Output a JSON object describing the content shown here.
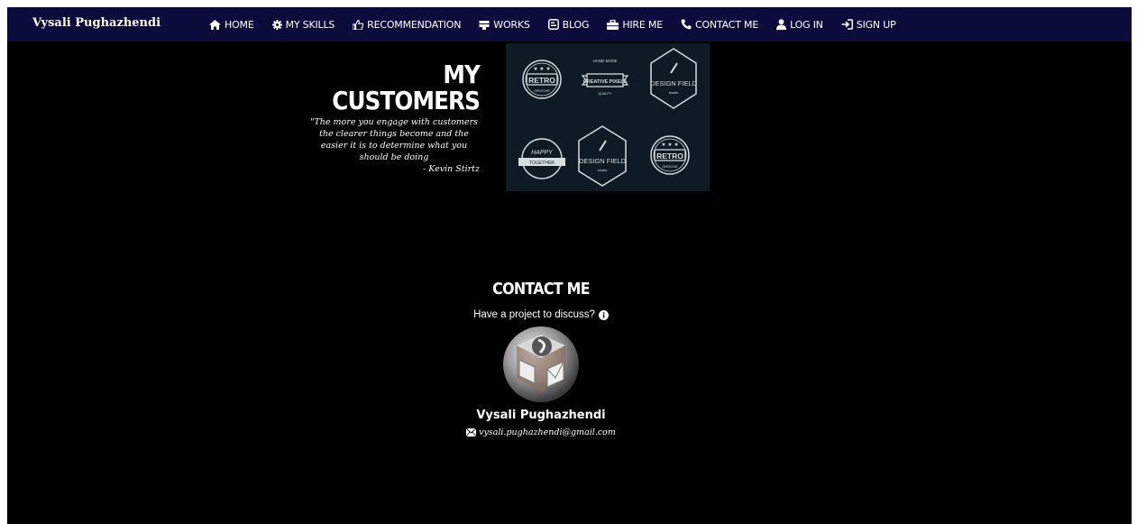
{
  "navbar": {
    "brand": "Vysali Pughazhendi",
    "items": [
      {
        "label": "HOME",
        "icon": "home-icon"
      },
      {
        "label": "MY SKILLS",
        "icon": "gear-icon"
      },
      {
        "label": "RECOMMENDATION",
        "icon": "thumbs-up-icon"
      },
      {
        "label": "WORKS",
        "icon": "briefcase-icon"
      },
      {
        "label": "BLOG",
        "icon": "blog-icon"
      },
      {
        "label": "HIRE ME",
        "icon": "hire-icon"
      },
      {
        "label": "CONTACT ME",
        "icon": "phone-icon"
      },
      {
        "label": "LOG IN",
        "icon": "user-icon"
      },
      {
        "label": "SIGN UP",
        "icon": "sign-in-icon"
      }
    ]
  },
  "customers": {
    "title_line1": "MY",
    "title_line2": "CUSTOMERS",
    "quote": "\"The more you engage with customers the clearer things become and the easier it is to determine what you should be doing",
    "quote_author": "- Kevin Stirtz",
    "badges": {
      "retro": "RETRO",
      "groove": "GROOVE",
      "hand_made": "HAND MADE",
      "creative_pixels": "CREATIVE PIXELS",
      "quality": "QUALITY",
      "design_field": "DESIGN FIELD",
      "studio": "studio",
      "happy": "HAPPY",
      "together": "TOGETHER"
    }
  },
  "contact": {
    "title": "CONTACT ME",
    "subtitle": "Have a project to discuss?",
    "name": "Vysali Pughazhendi",
    "email": "vysali.pughazhendi@gmail.com"
  },
  "colors": {
    "navbar_bg": "#0c0c3c",
    "page_bg": "#000000",
    "badge_panel_bg": "#0e1b24"
  }
}
